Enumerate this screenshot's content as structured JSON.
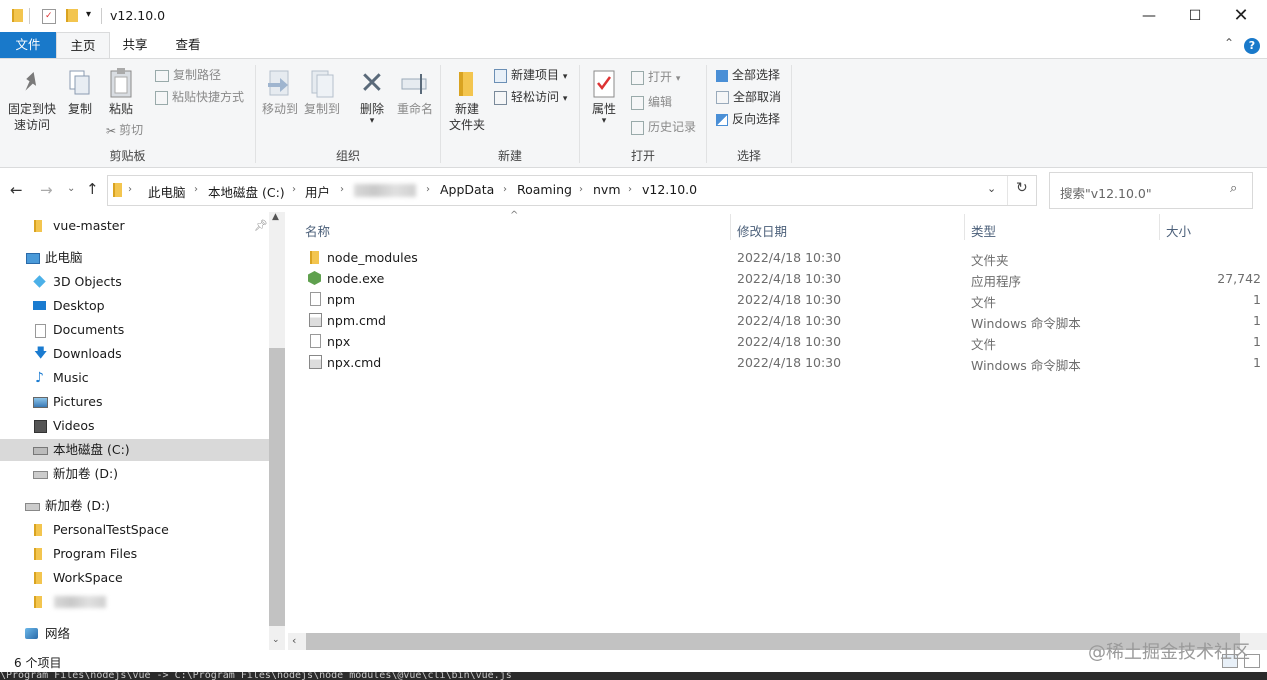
{
  "window": {
    "title": "v12.10.0"
  },
  "tabs": [
    {
      "label": "文件"
    },
    {
      "label": "主页"
    },
    {
      "label": "共享"
    },
    {
      "label": "查看"
    }
  ],
  "ribbon": {
    "clipboard": {
      "pin_label_1": "固定到快",
      "pin_label_2": "速访问",
      "copy": "复制",
      "paste": "粘贴",
      "copy_path": "复制路径",
      "paste_shortcut": "粘贴快捷方式",
      "cut": "剪切",
      "group": "剪贴板"
    },
    "organize": {
      "move_to": "移动到",
      "copy_to": "复制到",
      "delete": "删除",
      "rename": "重命名",
      "group": "组织"
    },
    "new": {
      "new_folder_1": "新建",
      "new_folder_2": "文件夹",
      "new_item": "新建项目",
      "easy_access": "轻松访问",
      "group": "新建"
    },
    "open": {
      "properties": "属性",
      "open": "打开",
      "edit": "编辑",
      "history": "历史记录",
      "group": "打开"
    },
    "select": {
      "select_all": "全部选择",
      "select_none": "全部取消",
      "invert": "反向选择",
      "group": "选择"
    }
  },
  "address": {
    "crumbs": [
      "此电脑",
      "本地磁盘 (C:)",
      "用户",
      "AppData",
      "Roaming",
      "nvm",
      "v12.10.0"
    ],
    "search_placeholder": "搜索\"v12.10.0\""
  },
  "nav": {
    "items": [
      {
        "label": "vue-master"
      },
      {
        "label": "此电脑"
      },
      {
        "label": "3D Objects"
      },
      {
        "label": "Desktop"
      },
      {
        "label": "Documents"
      },
      {
        "label": "Downloads"
      },
      {
        "label": "Music"
      },
      {
        "label": "Pictures"
      },
      {
        "label": "Videos"
      },
      {
        "label": "本地磁盘 (C:)"
      },
      {
        "label": "新加卷 (D:)"
      },
      {
        "label": "新加卷 (D:)"
      },
      {
        "label": "PersonalTestSpace"
      },
      {
        "label": "Program Files"
      },
      {
        "label": "WorkSpace"
      },
      {
        "label": "网络"
      }
    ]
  },
  "columns": {
    "name": "名称",
    "date": "修改日期",
    "type": "类型",
    "size": "大小"
  },
  "files": [
    {
      "name": "node_modules",
      "date": "2022/4/18 10:30",
      "type": "文件夹",
      "size": ""
    },
    {
      "name": "node.exe",
      "date": "2022/4/18 10:30",
      "type": "应用程序",
      "size": "27,742"
    },
    {
      "name": "npm",
      "date": "2022/4/18 10:30",
      "type": "文件",
      "size": "1"
    },
    {
      "name": "npm.cmd",
      "date": "2022/4/18 10:30",
      "type": "Windows 命令脚本",
      "size": "1"
    },
    {
      "name": "npx",
      "date": "2022/4/18 10:30",
      "type": "文件",
      "size": "1"
    },
    {
      "name": "npx.cmd",
      "date": "2022/4/18 10:30",
      "type": "Windows 命令脚本",
      "size": "1"
    }
  ],
  "status": {
    "count": "6 个项目"
  },
  "cmdline": "\\Program Files\\nodejs\\vue -> C:\\Program Files\\nodejs\\node_modules\\@vue\\cli\\bin\\vue.js",
  "watermark": "@稀土掘金技术社区",
  "colors": {
    "accent": "#1979ca",
    "folder": "#f3c54f",
    "selection": "#d9d9d9"
  }
}
